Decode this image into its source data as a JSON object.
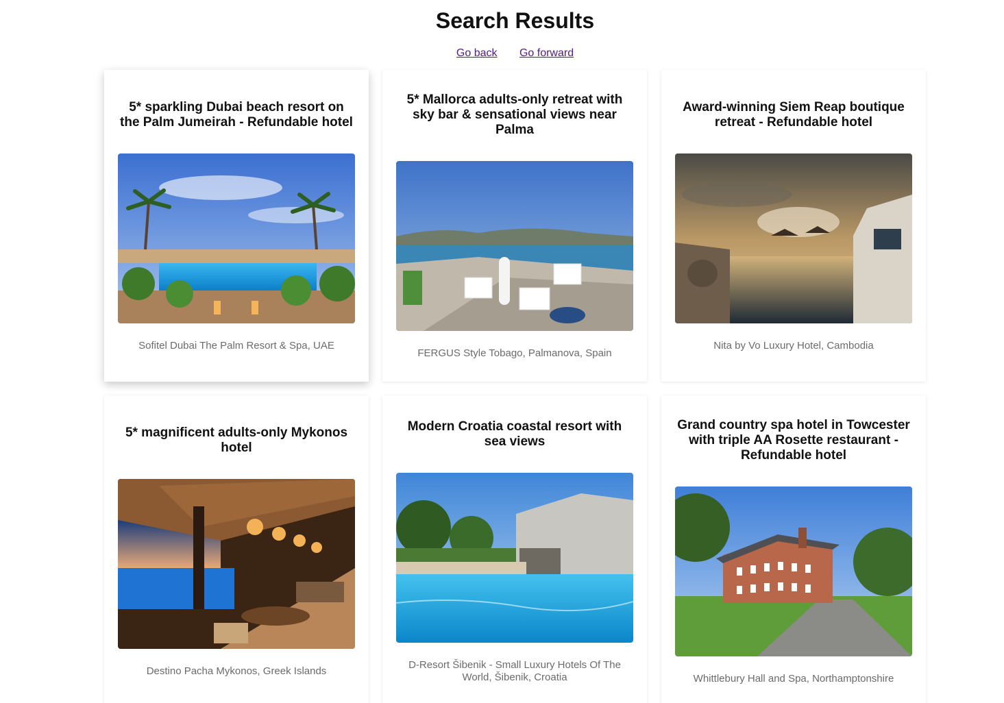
{
  "page": {
    "title": "Search Results",
    "nav": {
      "back_label": "Go back",
      "forward_label": "Go forward"
    }
  },
  "results": [
    {
      "title": "5* sparkling Dubai beach resort on the Palm Jumeirah - Refundable hotel",
      "location": "Sofitel Dubai The Palm Resort & Spa, UAE",
      "image": "resort-pool-palms-photo"
    },
    {
      "title": "5* Mallorca adults-only retreat with sky bar & sensational views near Palma",
      "location": "FERGUS Style Tobago, Palmanova, Spain",
      "image": "rooftop-terrace-sea-view-photo"
    },
    {
      "title": "Award-winning Siem Reap boutique retreat - Refundable hotel",
      "location": "Nita by Vo Luxury Hotel, Cambodia",
      "image": "sunset-rooftop-pool-photo"
    },
    {
      "title": "5* magnificent adults-only Mykonos hotel",
      "location": "Destino Pacha Mykonos, Greek Islands",
      "image": "lounge-bar-sea-dusk-photo"
    },
    {
      "title": "Modern Croatia coastal resort with sea views",
      "location": "D-Resort Šibenik - Small Luxury Hotels Of The World, Šibenik, Croatia",
      "image": "pool-stone-building-photo"
    },
    {
      "title": "Grand country spa hotel in Towcester with triple AA Rosette restaurant - Refundable hotel",
      "location": "Whittlebury Hall and Spa, Northamptonshire",
      "image": "brick-country-hotel-photo"
    }
  ]
}
